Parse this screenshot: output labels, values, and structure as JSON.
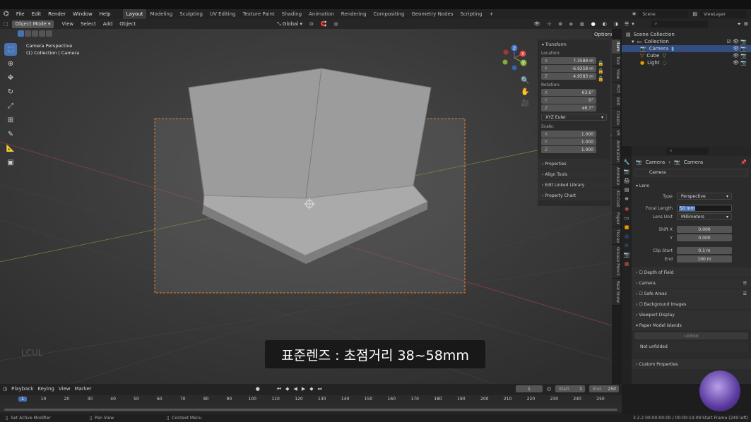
{
  "menubar": {
    "items": [
      "File",
      "Edit",
      "Render",
      "Window",
      "Help"
    ]
  },
  "workspaces": [
    "Layout",
    "Modeling",
    "Sculpting",
    "UV Editing",
    "Texture Paint",
    "Shading",
    "Animation",
    "Rendering",
    "Compositing",
    "Geometry Nodes",
    "Scripting"
  ],
  "add_workspace": "+",
  "scene": {
    "label": "Scene"
  },
  "view_layer": {
    "label": "ViewLayer"
  },
  "viewport_header": {
    "mode": "Object Mode",
    "menus": [
      "View",
      "Select",
      "Add",
      "Object"
    ],
    "orientation": "Global",
    "options": "Options"
  },
  "viewport": {
    "title": "Camera Perspective",
    "subtitle": "(1) Collection | Camera",
    "gizmo_labels": {
      "x": "X",
      "y": "Y",
      "z": "Z"
    }
  },
  "npanel": {
    "transform": "Transform",
    "location_label": "Location:",
    "location": [
      {
        "axis": "X",
        "value": "7.3589 m"
      },
      {
        "axis": "Y",
        "value": "-6.9258 m"
      },
      {
        "axis": "Z",
        "value": "4.9583 m"
      }
    ],
    "rotation_label": "Rotation:",
    "rotation": [
      {
        "axis": "X",
        "value": "63.6°"
      },
      {
        "axis": "Y",
        "value": "0°"
      },
      {
        "axis": "Z",
        "value": "46.7°"
      }
    ],
    "rotation_mode": "XYZ Euler",
    "scale_label": "Scale:",
    "scale": [
      {
        "axis": "X",
        "value": "1.000"
      },
      {
        "axis": "Y",
        "value": "1.000"
      },
      {
        "axis": "Z",
        "value": "1.000"
      }
    ],
    "sections": [
      "Properties",
      "Align Tools",
      "Edit Linked Library",
      "Property Chart"
    ]
  },
  "npanel_tabs": [
    "Item",
    "Tool",
    "View",
    "PDT",
    "Edit",
    "Create",
    "VR",
    "Animation",
    "Animate",
    "3D-Coat",
    "Paper",
    "Tissue",
    "Grease Pencil",
    "Real Snow"
  ],
  "outliner": {
    "root": "Scene Collection",
    "collection": "Collection",
    "items": [
      "Camera",
      "Cube",
      "Light"
    ]
  },
  "properties": {
    "breadcrumb": [
      "Camera",
      "Camera"
    ],
    "datablock": "Camera",
    "lens_panel": "Lens",
    "type_label": "Type",
    "type_value": "Perspective",
    "focal_label": "Focal Length",
    "focal_value": "50 mm",
    "unit_label": "Lens Unit",
    "unit_value": "Millimeters",
    "shift_x_label": "Shift X",
    "shift_x": "0.000",
    "shift_y_label": "Y",
    "shift_y": "0.000",
    "clip_start_label": "Clip Start",
    "clip_start": "0.1 m",
    "clip_end_label": "End",
    "clip_end": "100 m",
    "panels": [
      "Depth of Field",
      "Camera",
      "Safe Areas",
      "Background Images",
      "Viewport Display"
    ],
    "paper_panel": "Paper Model Islands",
    "unfold": "Unfold",
    "not_unfolded": "Not unfolded",
    "custom": "Custom Properties"
  },
  "timeline": {
    "menus": [
      "Playback",
      "Keying",
      "View",
      "Marker"
    ],
    "current_frame": "1",
    "start_label": "Start",
    "start": "1",
    "end_label": "End",
    "end": "250",
    "ticks": [
      "1",
      "10",
      "20",
      "30",
      "40",
      "50",
      "60",
      "70",
      "80",
      "90",
      "100",
      "110",
      "120",
      "130",
      "140",
      "150",
      "160",
      "170",
      "180",
      "190",
      "200",
      "210",
      "220",
      "230",
      "240",
      "250"
    ]
  },
  "statusbar": {
    "left": "Set Active Modifier",
    "mid": "Pan View",
    "right": "Context Menu",
    "info": "3.2.2  00:00:00:00 / 00:00:10:09  Start Frame (249 left)"
  },
  "subtitle": "표준렌즈 : 초점거리 38~58mm",
  "watermark": "LCUL"
}
